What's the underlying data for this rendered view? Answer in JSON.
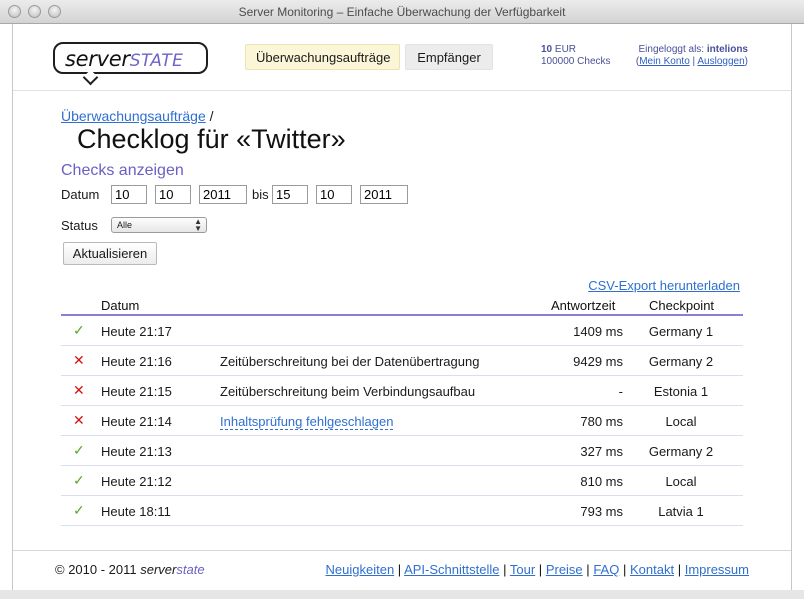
{
  "window": {
    "title": "Server Monitoring – Einfache Überwachung der Verfügbarkeit"
  },
  "header": {
    "logo": {
      "part1": "server",
      "part2": "STATE"
    },
    "nav": [
      {
        "label": "Überwachungsaufträge",
        "active": true
      },
      {
        "label": "Empfänger",
        "active": false
      }
    ],
    "credit": {
      "amount": "10",
      "currency": "EUR",
      "checks": "100000",
      "checks_unit": "Checks"
    },
    "user": {
      "prefix": "Eingeloggt als:",
      "name": "intelions",
      "my_account": "Mein Konto",
      "logout": "Ausloggen"
    }
  },
  "breadcrumb": {
    "link": "Überwachungsaufträge",
    "separator": "/"
  },
  "page_title": "Checklog für «Twitter»",
  "filter": {
    "section_title": "Checks anzeigen",
    "date_label": "Datum",
    "from": {
      "day": "10",
      "month": "10",
      "year": "2011"
    },
    "to_label": "bis",
    "to": {
      "day": "15",
      "month": "10",
      "year": "2011"
    },
    "status_label": "Status",
    "status_value": "Alle",
    "update_button": "Aktualisieren"
  },
  "csv_export": "CSV-Export herunterladen",
  "table": {
    "headers": {
      "date": "Datum",
      "response": "Antwortzeit",
      "checkpoint": "Checkpoint"
    },
    "rows": [
      {
        "status": "ok",
        "date": "Heute 21:17",
        "message": "",
        "response": "1409 ms",
        "checkpoint": "Germany 1"
      },
      {
        "status": "fail",
        "date": "Heute 21:16",
        "message": "Zeitüberschreitung bei der Datenübertragung",
        "response": "9429 ms",
        "checkpoint": "Germany 2"
      },
      {
        "status": "fail",
        "date": "Heute 21:15",
        "message": "Zeitüberschreitung beim Verbindungsaufbau",
        "response": "-",
        "checkpoint": "Estonia 1"
      },
      {
        "status": "fail",
        "date": "Heute 21:14",
        "message": "Inhaltsprüfung fehlgeschlagen",
        "message_link": true,
        "response": "780 ms",
        "checkpoint": "Local"
      },
      {
        "status": "ok",
        "date": "Heute 21:13",
        "message": "",
        "response": "327 ms",
        "checkpoint": "Germany 2"
      },
      {
        "status": "ok",
        "date": "Heute 21:12",
        "message": "",
        "response": "810 ms",
        "checkpoint": "Local"
      },
      {
        "status": "ok",
        "date": "Heute 18:11",
        "message": "",
        "response": "793 ms",
        "checkpoint": "Latvia 1"
      }
    ]
  },
  "footer": {
    "copyright": "© 2010 - 2011",
    "brand_part1": "server",
    "brand_part2": "state",
    "links": [
      "Neuigkeiten",
      "API-Schnittstelle",
      "Tour",
      "Preise",
      "FAQ",
      "Kontakt",
      "Impressum"
    ],
    "separator": "|"
  },
  "colors": {
    "accent": "#6a5fc4",
    "link": "#2f6fd0",
    "ok": "#5aa92a",
    "fail": "#d21414",
    "active_tab": "#fbf6d7"
  },
  "icons": {
    "ok": "check-icon",
    "fail": "cross-icon"
  }
}
